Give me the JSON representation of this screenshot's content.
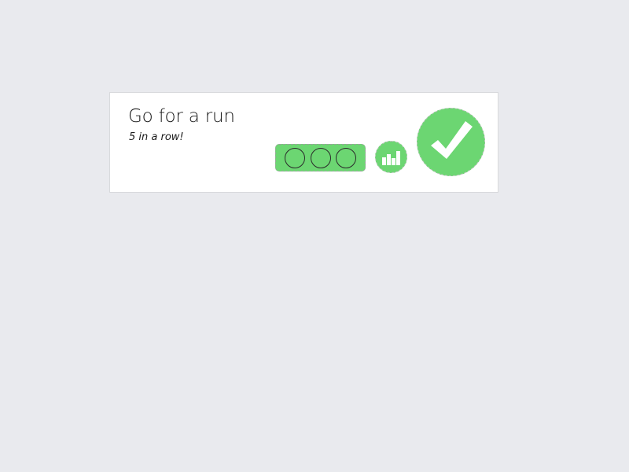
{
  "habit": {
    "title": "Go for a run",
    "streak_text": "5 in a row!",
    "history_days": [
      {
        "state": "empty"
      },
      {
        "state": "empty"
      },
      {
        "state": "empty"
      }
    ],
    "completed": true
  },
  "icons": {
    "stats": "bar-chart-icon",
    "complete": "checkmark-icon"
  },
  "colors": {
    "page_background": "#e9eaee",
    "card_background": "#ffffff",
    "accent_green": "#6cd672",
    "text": "#1a1a1a"
  }
}
